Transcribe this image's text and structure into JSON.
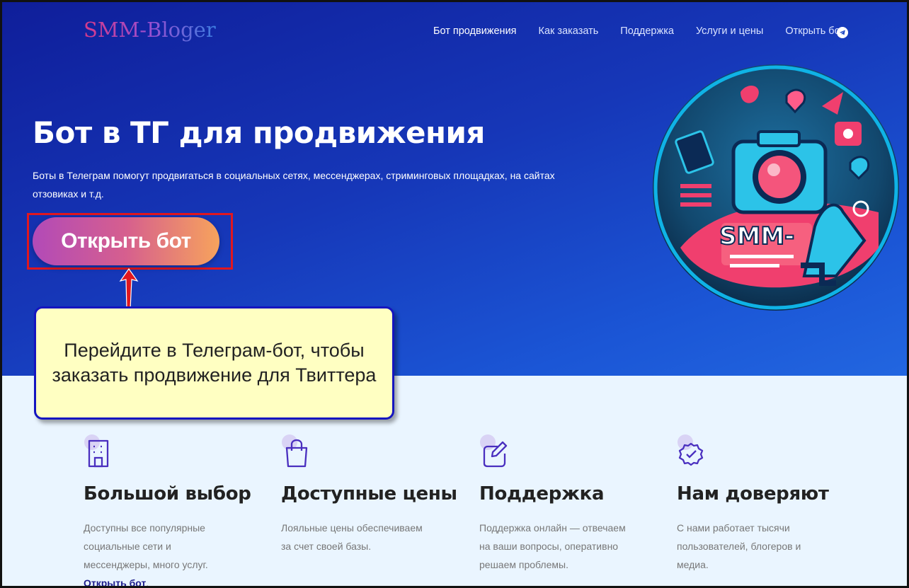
{
  "header": {
    "logo": "SMM-Bloger",
    "nav": [
      "Бот продвижения",
      "Как заказать",
      "Поддержка",
      "Услуги и цены",
      "Открыть бот"
    ],
    "telegram_icon": "telegram-icon"
  },
  "hero": {
    "title": "Бот в ТГ для продвижения",
    "subtitle": "Боты в Телеграм помогут продвигаться в социальных сетях, мессенджерах, стриминговых площадках, на сайтах отзовиках и т.д.",
    "cta_label": "Открыть бот",
    "illustration_text": "SMM-"
  },
  "callout": {
    "text": "Перейдите в Телеграм-бот, чтобы заказать продвижение для Твиттера"
  },
  "features": [
    {
      "icon": "building-icon",
      "title": "Большой выбор",
      "text": "Доступны все популярные социальные сети и мессенджеры, много услуг.",
      "link": "Открыть бот",
      "link_suffix": "."
    },
    {
      "icon": "shopping-bag-icon",
      "title": "Доступные цены",
      "text": "Лояльные цены обеспечиваем за счет своей базы."
    },
    {
      "icon": "edit-icon",
      "title": "Поддержка",
      "text": "Поддержка онлайн — отвечаем на ваши вопросы, оперативно решаем проблемы."
    },
    {
      "icon": "verified-badge-icon",
      "title": "Нам доверяют",
      "text": "С нами работает тысячи пользователей, блогеров и медиа."
    }
  ],
  "colors": {
    "hero_gradient_start": "#0f1e9a",
    "hero_gradient_end": "#2266e0",
    "cta_gradient_start": "#b24ab8",
    "cta_gradient_end": "#f7a35c",
    "highlight_border": "#e0171f",
    "callout_bg": "#ffffc2",
    "callout_border": "#1515c0",
    "icon_color": "#4a2fbf"
  }
}
